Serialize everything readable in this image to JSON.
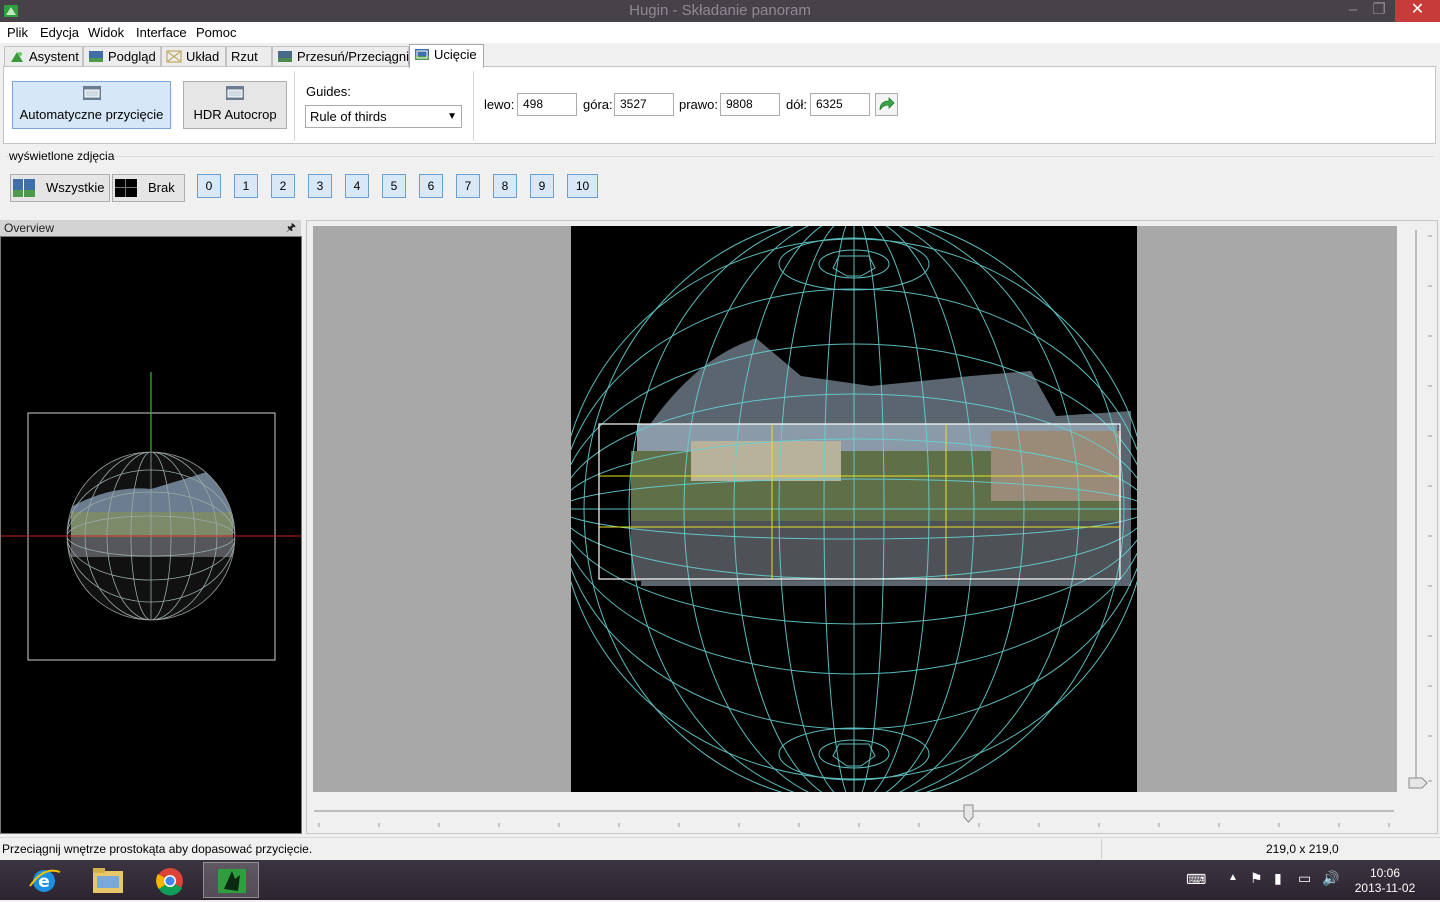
{
  "window": {
    "title": "Hugin - Składanie panoram",
    "controls": {
      "minimize": "–",
      "restore": "❐",
      "close": "✕"
    }
  },
  "menu": [
    "Plik",
    "Edycja",
    "Widok",
    "Interface",
    "Pomoc"
  ],
  "tabs": [
    {
      "label": "Asystent",
      "icon": "assistant-icon"
    },
    {
      "label": "Podgląd",
      "icon": "preview-icon"
    },
    {
      "label": "Układ",
      "icon": "layout-icon"
    },
    {
      "label": "Rzut",
      "icon": ""
    },
    {
      "label": "Przesuń/Przeciągnij",
      "icon": "move-drag-icon"
    },
    {
      "label": "Ucięcie",
      "icon": "crop-icon",
      "active": true
    }
  ],
  "crop_tools": {
    "auto_crop_label": "Automatyczne przycięcie",
    "hdr_autocrop_label": "HDR Autocrop",
    "guides_label": "Guides:",
    "guides_value": "Rule of thirds",
    "left_label": "lewo:",
    "left_value": "498",
    "top_label": "góra:",
    "top_value": "3527",
    "right_label": "prawo:",
    "right_value": "9808",
    "bottom_label": "dół:",
    "bottom_value": "6325",
    "apply_icon": "apply-arrow-icon"
  },
  "displayed_images": {
    "group_label": "wyświetlone zdjęcia",
    "all_label": "Wszystkie",
    "none_label": "Brak",
    "numbers": [
      "0",
      "1",
      "2",
      "3",
      "4",
      "5",
      "6",
      "7",
      "8",
      "9",
      "10"
    ]
  },
  "overview": {
    "title": "Overview",
    "pin_icon": "pin-icon",
    "pin_glyph": "🖈"
  },
  "status": {
    "message": "Przeciągnij wnętrze prostokąta aby dopasować przycięcie.",
    "dimensions": "219,0 x 219,0"
  },
  "taskbar": {
    "apps": [
      "internet-explorer-icon",
      "file-explorer-icon",
      "chrome-icon",
      "hugin-icon"
    ],
    "time": "10:06",
    "date": "2013-11-02"
  },
  "colors": {
    "grid": "#66d0d0",
    "guides": "#e8e020",
    "crop_frame": "#ffffff",
    "selected_button": "#d6e8f8",
    "number_button": "#d9e8f6"
  }
}
